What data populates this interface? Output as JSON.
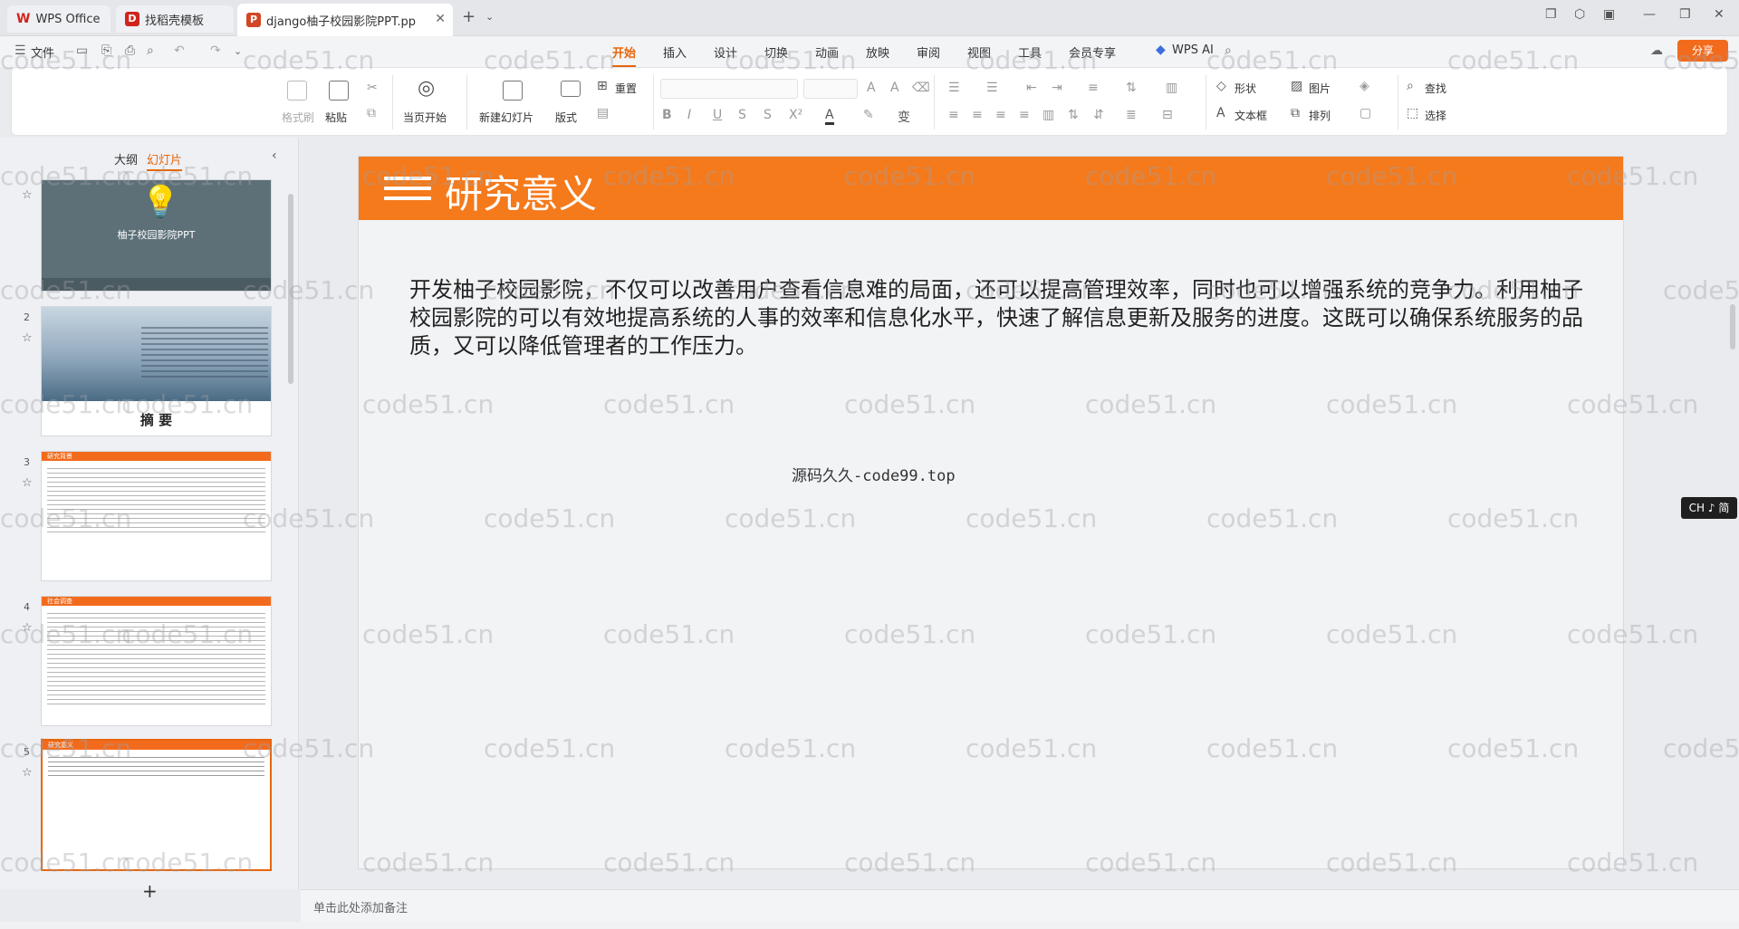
{
  "tabs": [
    {
      "label": "WPS Office"
    },
    {
      "label": "找稻壳模板"
    },
    {
      "label": "django柚子校园影院PPT.pp"
    }
  ],
  "menu": {
    "file": "文件",
    "items": [
      "开始",
      "插入",
      "设计",
      "切换",
      "动画",
      "放映",
      "审阅",
      "视图",
      "工具",
      "会员专享"
    ],
    "active": "开始",
    "wps_ai": "WPS AI",
    "share": "分享"
  },
  "ribbon": {
    "format_painter": "格式刷",
    "paste": "粘贴",
    "from_current": "当页开始",
    "new_slide": "新建幻灯片",
    "layout": "版式",
    "reset": "重置",
    "shape": "形状",
    "picture": "图片",
    "find": "查找",
    "textbox": "文本框",
    "arrange": "排列",
    "select": "选择"
  },
  "sidepanel": {
    "outline_tab": "大纲",
    "slides_tab": "幻灯片",
    "thumbs": [
      {
        "num": "",
        "title": "柚子校园影院PPT"
      },
      {
        "num": "2",
        "title": "摘  要"
      },
      {
        "num": "3",
        "header": "研究背景"
      },
      {
        "num": "4",
        "header": "社会调查"
      },
      {
        "num": "5",
        "header": "研究意义"
      }
    ]
  },
  "slide": {
    "title": "研究意义",
    "body": "开发柚子校园影院，不仅可以改善用户查看信息难的局面，还可以提高管理效率，同时也可以增强系统的竞争力。利用柚子校园影院的可以有效地提高系统的人事的效率和信息化水平，快速了解信息更新及服务的进度。这既可以确保系统服务的品质，又可以降低管理者的工作压力。",
    "source": "源码久久-code99.top"
  },
  "notes_placeholder": "单击此处添加备注",
  "ime": "CH ♪ 简",
  "watermark": "code51.cn",
  "colors": {
    "accent": "#e8660c",
    "slide_header": "#f47a1c"
  }
}
